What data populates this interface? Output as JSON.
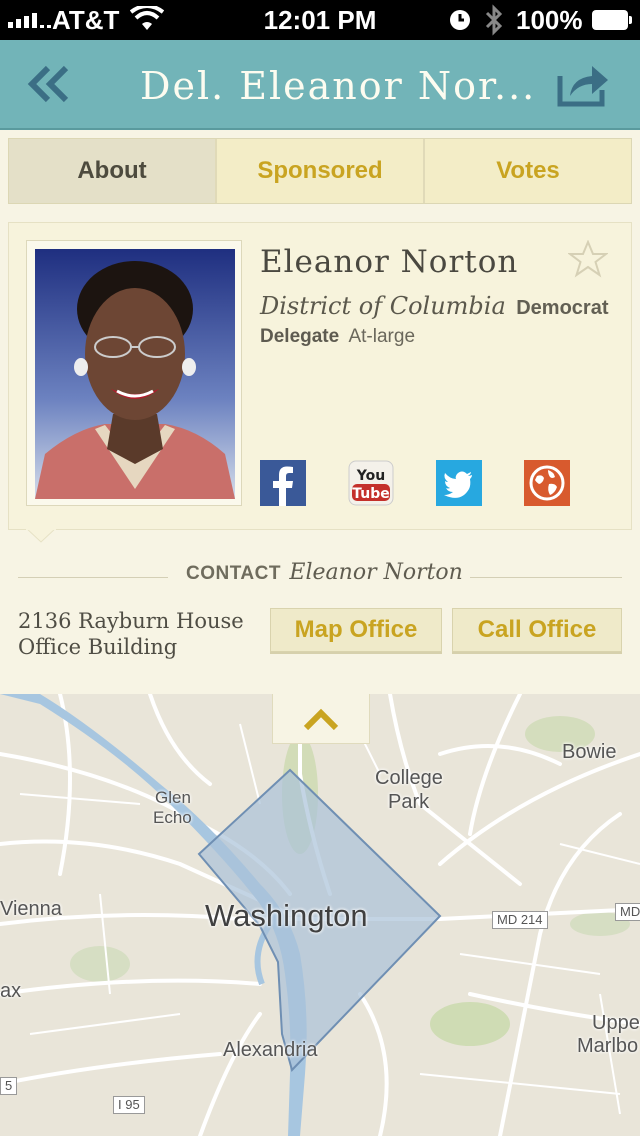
{
  "status_bar": {
    "carrier": "AT&T",
    "time": "12:01 PM",
    "battery": "100%"
  },
  "nav": {
    "title": "Del. Eleanor Nor...",
    "back_icon": "double-chevron-left-icon",
    "share_icon": "share-icon"
  },
  "tabs": [
    {
      "label": "About",
      "active": true
    },
    {
      "label": "Sponsored",
      "active": false
    },
    {
      "label": "Votes",
      "active": false
    }
  ],
  "profile": {
    "name": "Eleanor  Norton",
    "district": "District of Columbia",
    "party": "Democrat",
    "role": "Delegate",
    "seat": "At-large",
    "favorite_icon": "star-icon",
    "social": [
      "facebook-icon",
      "youtube-icon",
      "twitter-icon",
      "website-icon"
    ]
  },
  "contact": {
    "label": "CONTACT",
    "name": "Eleanor Norton",
    "address_line1": "2136 Rayburn House",
    "address_line2": "Office Building",
    "map_button": "Map Office",
    "call_button": "Call Office"
  },
  "map": {
    "labels": [
      "Bowie",
      "College",
      "Park",
      "Glen",
      "Echo",
      "Vienna",
      "Washington",
      "ax",
      "Alexandria",
      "Uppe",
      "Marlbo"
    ],
    "shields": [
      "MD 214",
      "MD",
      "I 95",
      "5"
    ],
    "collapse_icon": "chevron-up-icon"
  },
  "colors": {
    "navbar": "#72b4b8",
    "accent": "#c9a421",
    "background": "#f7f4e4",
    "district_fill": "#a9c2d8"
  }
}
